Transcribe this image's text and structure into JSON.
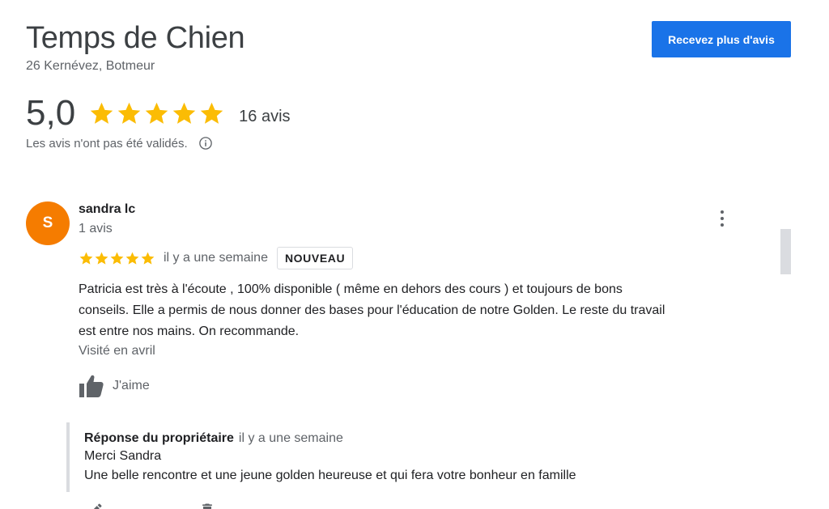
{
  "business": {
    "title": "Temps de Chien",
    "address": "26 Kernévez, Botmeur",
    "cta_label": "Recevez plus d'avis"
  },
  "summary": {
    "rating": "5,0",
    "stars": 5,
    "count_label": "16 avis",
    "validation_note": "Les avis n'ont pas été validés."
  },
  "review": {
    "avatar_letter": "S",
    "avatar_color": "#f57c00",
    "name": "sandra lc",
    "reviewer_count": "1 avis",
    "stars": 5,
    "date": "il y a une semaine",
    "badge": "NOUVEAU",
    "text_lines": [
      "Patricia est très à l'écoute , 100% disponible ( même en dehors des cours ) et  toujours de bons",
      "conseils. Elle a permis de nous donner des bases pour l'éducation de notre Golden. Le reste du travail",
      "est entre nos mains. On recommande."
    ],
    "visited": "Visité en avril",
    "like_label": "J'aime"
  },
  "owner_reply": {
    "label": "Réponse du propriétaire",
    "date": "il y a une semaine",
    "lines": [
      "Merci Sandra",
      "Une belle rencontre et une jeune golden heureuse et qui fera votre bonheur en famille"
    ]
  },
  "icons": {
    "star": "star-icon",
    "info": "info-icon",
    "more": "more-vert-icon",
    "like": "thumb-up-icon",
    "edit": "edit-icon",
    "delete": "delete-icon"
  },
  "colors": {
    "accent": "#1a73e8",
    "star": "#fbbc04"
  }
}
